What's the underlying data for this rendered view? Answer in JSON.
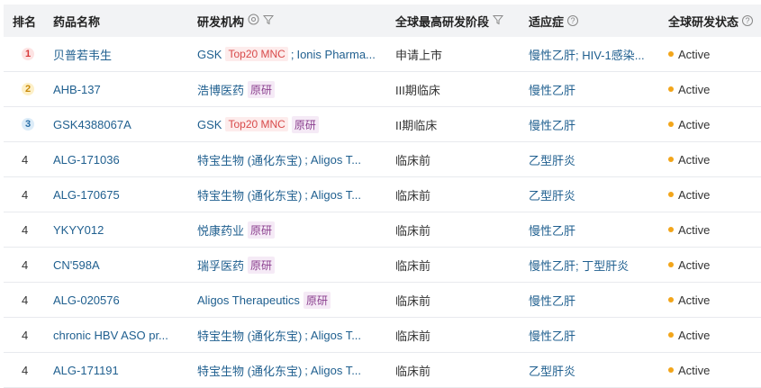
{
  "headers": {
    "rank": "排名",
    "name": "药品名称",
    "org": "研发机构",
    "stage": "全球最高研发阶段",
    "indication": "适应症",
    "status": "全球研发状态"
  },
  "tags": {
    "mnc": "Top20 MNC",
    "original": "原研"
  },
  "rows": [
    {
      "rank": "1",
      "name": "贝普若韦生",
      "org1": "GSK",
      "org1_tag": "Top20 MNC",
      "sep": ";",
      "org2": "Ionis Pharma...",
      "stage": "申请上市",
      "indication": "慢性乙肝; HIV-1感染...",
      "status": "Active"
    },
    {
      "rank": "2",
      "name": "AHB-137",
      "org1": "浩博医药",
      "org1_tag": "原研",
      "stage": "III期临床",
      "indication": "慢性乙肝",
      "status": "Active"
    },
    {
      "rank": "3",
      "name": "GSK4388067A",
      "org1": "GSK",
      "org1_tag": "Top20 MNC",
      "org1_tag2": "原研",
      "stage": "II期临床",
      "indication": "慢性乙肝",
      "status": "Active"
    },
    {
      "rank": "4",
      "name": "ALG-171036",
      "org1": "特宝生物 (通化东宝)",
      "sep": ";",
      "org2": "Aligos T...",
      "stage": "临床前",
      "indication": "乙型肝炎",
      "status": "Active"
    },
    {
      "rank": "4",
      "name": "ALG-170675",
      "org1": "特宝生物 (通化东宝)",
      "sep": ";",
      "org2": "Aligos T...",
      "stage": "临床前",
      "indication": "乙型肝炎",
      "status": "Active"
    },
    {
      "rank": "4",
      "name": "YKYY012",
      "org1": "悦康药业",
      "org1_tag": "原研",
      "stage": "临床前",
      "indication": "慢性乙肝",
      "status": "Active"
    },
    {
      "rank": "4",
      "name": "CN'598A",
      "org1": "瑞孚医药",
      "org1_tag": "原研",
      "stage": "临床前",
      "indication": "慢性乙肝; 丁型肝炎",
      "status": "Active"
    },
    {
      "rank": "4",
      "name": "ALG-020576",
      "org1": "Aligos Therapeutics",
      "org1_tag": "原研",
      "stage": "临床前",
      "indication": "慢性乙肝",
      "status": "Active"
    },
    {
      "rank": "4",
      "name": "chronic HBV ASO pr...",
      "org1": "特宝生物 (通化东宝)",
      "sep": ";",
      "org2": "Aligos T...",
      "stage": "临床前",
      "indication": "慢性乙肝",
      "status": "Active"
    },
    {
      "rank": "4",
      "name": "ALG-171191",
      "org1": "特宝生物 (通化东宝)",
      "sep": ";",
      "org2": "Aligos T...",
      "stage": "临床前",
      "indication": "乙型肝炎",
      "status": "Active"
    }
  ],
  "colors": {
    "link": "#1f5f8f",
    "status_dot": "#f2a51a",
    "header_bg": "#f2f3f5"
  }
}
